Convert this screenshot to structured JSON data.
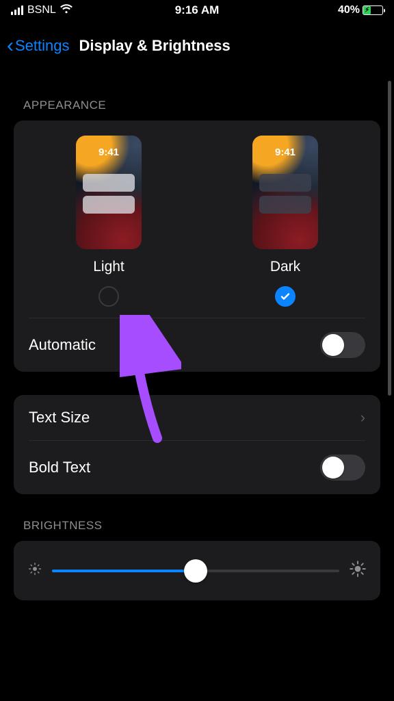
{
  "status": {
    "carrier": "BSNL",
    "time": "9:16 AM",
    "battery_pct": "40%"
  },
  "nav": {
    "back_label": "Settings",
    "title": "Display & Brightness"
  },
  "appearance": {
    "section_label": "APPEARANCE",
    "mock_time": "9:41",
    "light_label": "Light",
    "dark_label": "Dark",
    "selected": "dark",
    "automatic_label": "Automatic",
    "automatic_on": false
  },
  "text": {
    "text_size_label": "Text Size",
    "bold_text_label": "Bold Text",
    "bold_on": false
  },
  "brightness": {
    "section_label": "BRIGHTNESS",
    "value_pct": 50
  }
}
